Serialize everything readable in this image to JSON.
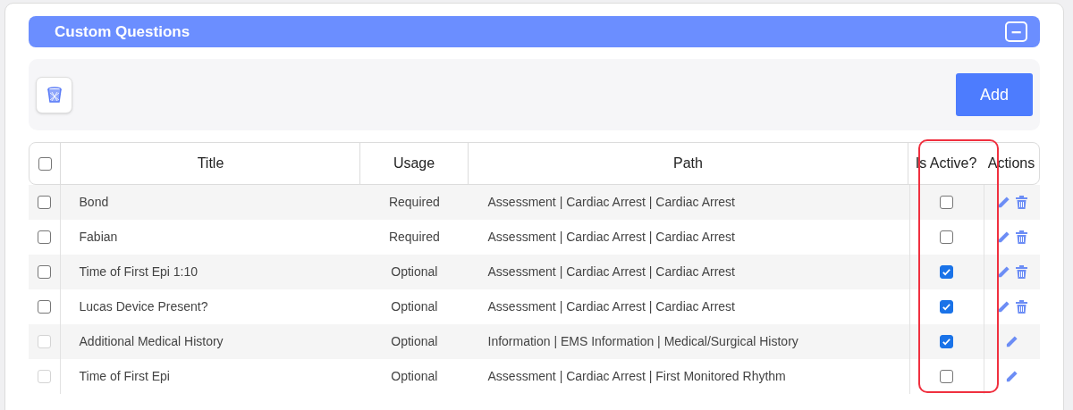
{
  "panel": {
    "title": "Custom Questions",
    "collapse_symbol": "−"
  },
  "toolbar": {
    "add_label": "Add"
  },
  "table": {
    "columns": [
      {
        "label": "Title",
        "highlighted": false
      },
      {
        "label": "Usage",
        "highlighted": false
      },
      {
        "label": "Path",
        "highlighted": false
      },
      {
        "label": "Is Active?",
        "highlighted": true
      },
      {
        "label": "Actions",
        "highlighted": false
      }
    ],
    "select_all": false,
    "rows": [
      {
        "title": "Bond",
        "usage": "Required",
        "path": "Assessment | Cardiac Arrest | Cardiac Arrest",
        "selected": false,
        "disabled": false,
        "active": false,
        "deletable": true
      },
      {
        "title": "Fabian",
        "usage": "Required",
        "path": "Assessment | Cardiac Arrest | Cardiac Arrest",
        "selected": false,
        "disabled": false,
        "active": false,
        "deletable": true
      },
      {
        "title": "Time of First Epi 1:10",
        "usage": "Optional",
        "path": "Assessment | Cardiac Arrest | Cardiac Arrest",
        "selected": false,
        "disabled": false,
        "active": true,
        "deletable": true
      },
      {
        "title": "Lucas Device Present?",
        "usage": "Optional",
        "path": "Assessment | Cardiac Arrest | Cardiac Arrest",
        "selected": false,
        "disabled": false,
        "active": true,
        "deletable": true
      },
      {
        "title": "Additional Medical History",
        "usage": "Optional",
        "path": "Information | EMS Information | Medical/Surgical History",
        "selected": false,
        "disabled": true,
        "active": true,
        "deletable": false
      },
      {
        "title": "Time of First Epi",
        "usage": "Optional",
        "path": "Assessment | Cardiac Arrest | First Monitored Rhythm",
        "selected": false,
        "disabled": true,
        "active": false,
        "deletable": false
      }
    ]
  }
}
